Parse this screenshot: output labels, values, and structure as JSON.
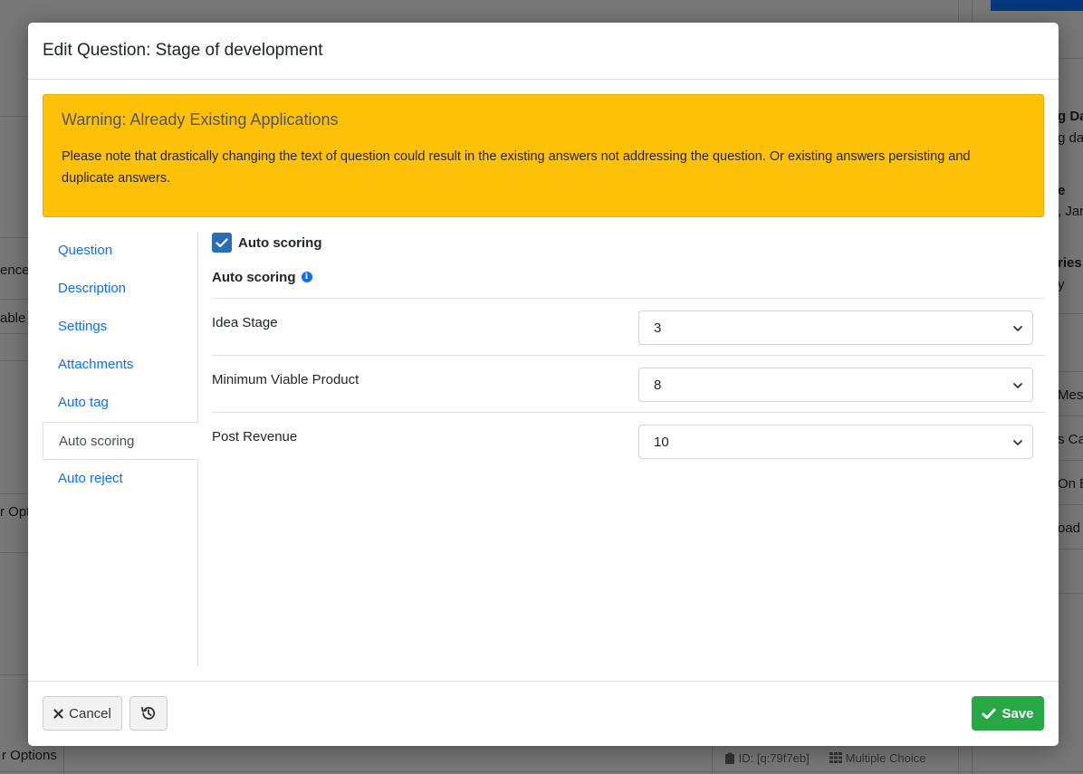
{
  "background": {
    "right_texts": [
      "g Da",
      "g dat",
      "e",
      ", Jar",
      "ries",
      "y",
      "Mess",
      "s Ca",
      "On Bo",
      "oad I"
    ],
    "left_texts": [
      "ences",
      "able",
      "r Opti",
      "r Options"
    ],
    "footer_id": "ID: [q:79f7eb]",
    "footer_type": "Multiple Choice"
  },
  "modal": {
    "title": "Edit Question: Stage of development"
  },
  "warning": {
    "title": "Warning: Already Existing Applications",
    "text": "Please note that drastically changing the text of question could result in the existing answers not addressing the question. Or existing answers persisting and duplicate answers."
  },
  "nav": {
    "items": [
      {
        "label": "Question"
      },
      {
        "label": "Description"
      },
      {
        "label": "Settings"
      },
      {
        "label": "Attachments"
      },
      {
        "label": "Auto tag"
      },
      {
        "label": "Auto scoring"
      },
      {
        "label": "Auto reject"
      }
    ],
    "active": "Auto scoring"
  },
  "auto_scoring": {
    "checkbox_label": "Auto scoring",
    "checked": true,
    "section_label": "Auto scoring",
    "rows": [
      {
        "label": "Idea Stage",
        "value": "3"
      },
      {
        "label": "Minimum Viable Product",
        "value": "8"
      },
      {
        "label": "Post Revenue",
        "value": "10"
      }
    ]
  },
  "footer": {
    "cancel_label": "Cancel",
    "save_label": "Save"
  },
  "colors": {
    "warning": "#ffc107",
    "link": "#0d6efd",
    "save": "#28a745",
    "checkbox": "#2a6db5"
  }
}
